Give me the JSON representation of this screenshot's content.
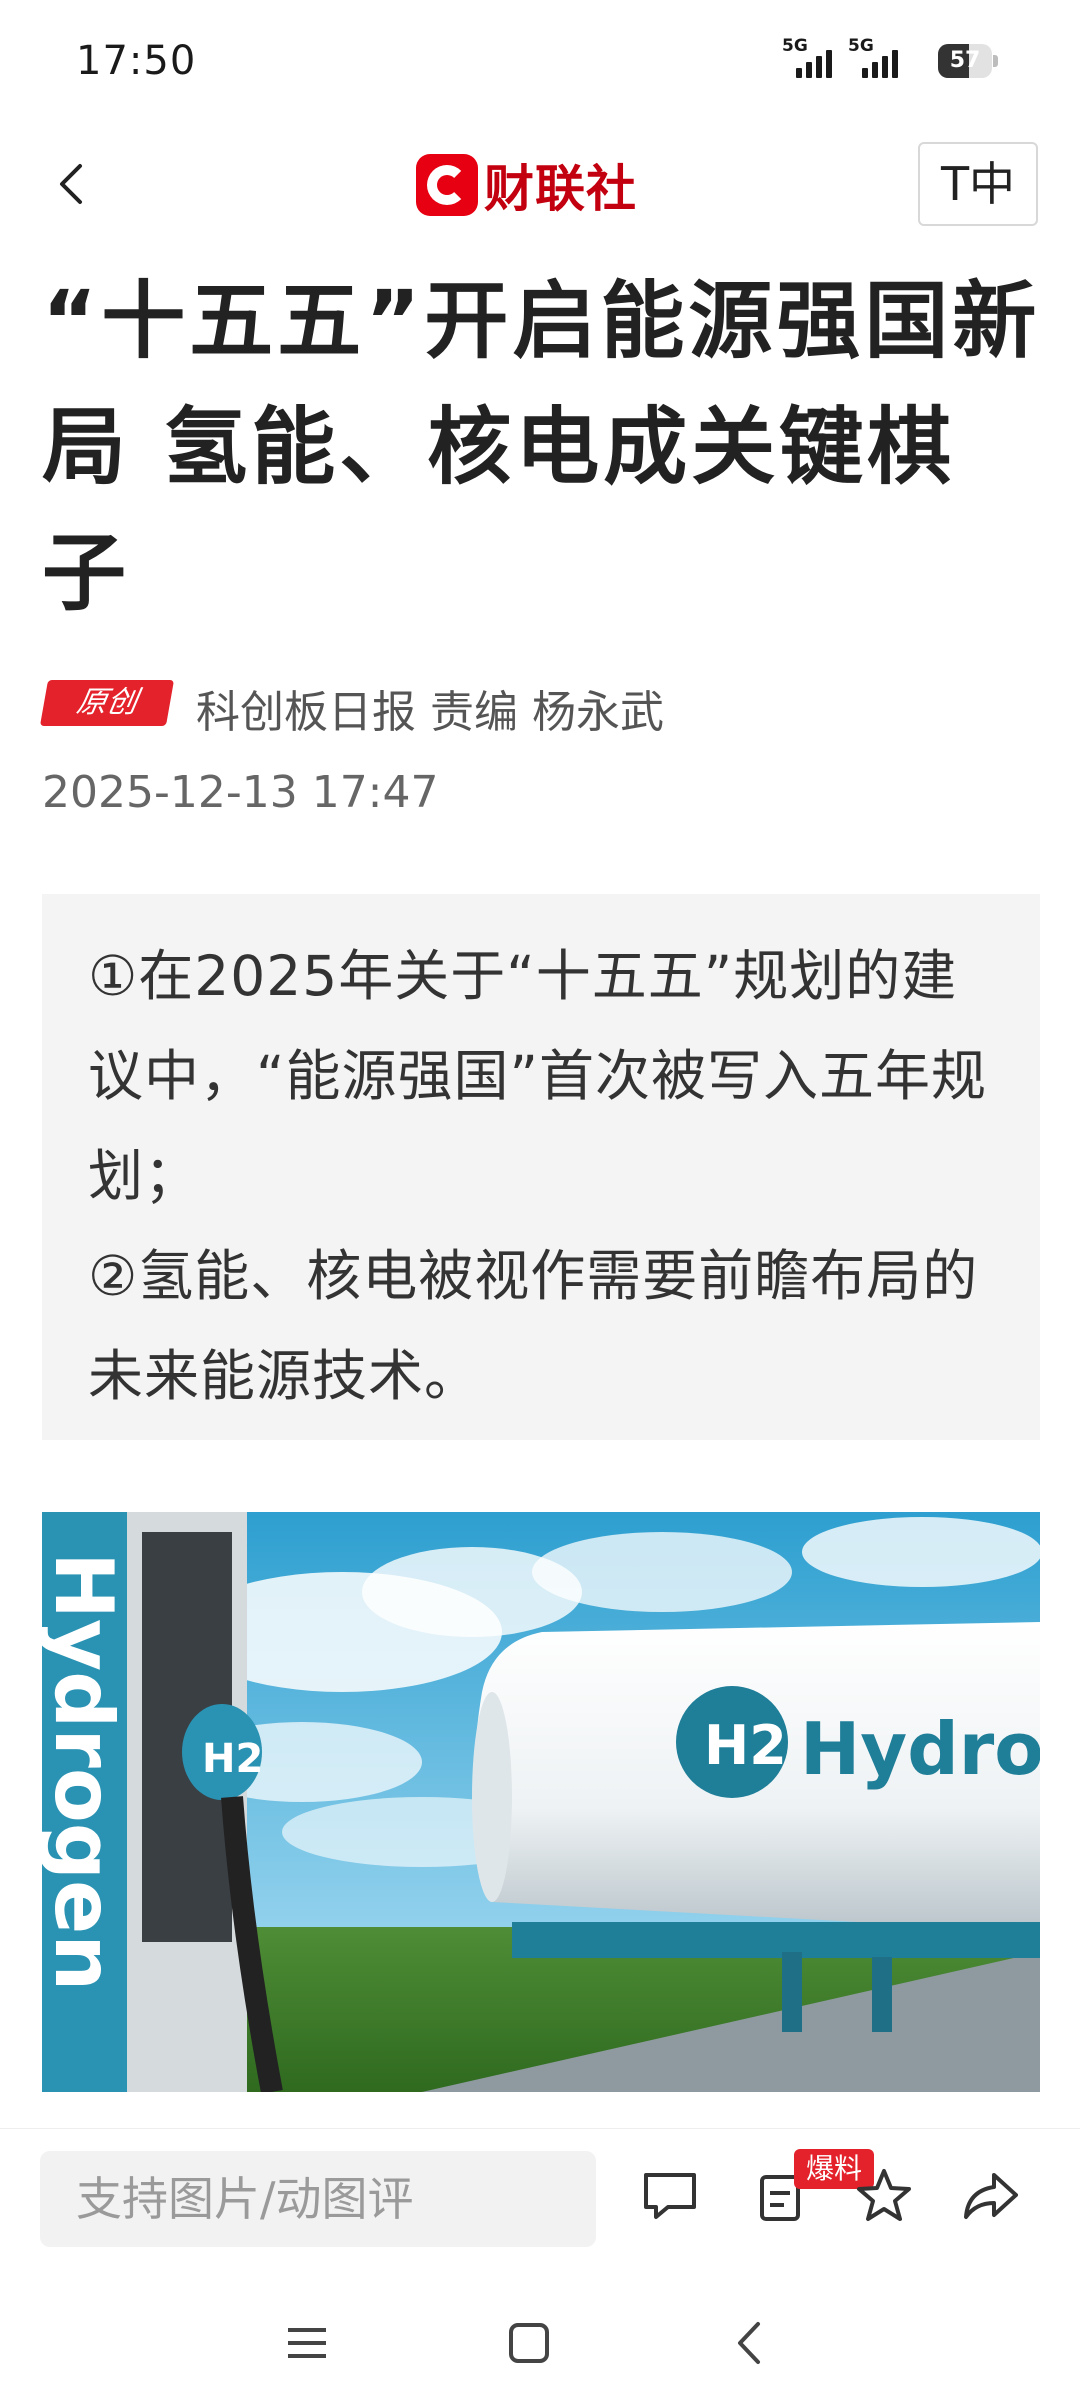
{
  "status": {
    "time": "17:50",
    "signal_1": "5G",
    "signal_2": "5G",
    "battery": "57"
  },
  "nav": {
    "logo_text": "财联社",
    "font_toggle": "T中"
  },
  "article": {
    "title": "“十五五”开启能源强国新局 氢能、核电成关键棋子",
    "badge": "原创",
    "author_line": "科创板日报  责编 杨永武",
    "date": "2025-12-13 17:47",
    "summary": [
      "①在2025年关于“十五五”规划的建议中，“能源强国”首次被写入五年规划；",
      "②氢能、核电被视作需要前瞻布局的未来能源技术。"
    ],
    "image": {
      "side_text": "Hydrogen",
      "nozzle_text": "H2",
      "tank_text": "Hydrogen",
      "tank_logo": "H2"
    }
  },
  "toolbar": {
    "comment_placeholder": "支持图片/动图评",
    "tip_badge": "爆料"
  },
  "icons": {
    "back": "chevron-left-icon",
    "comment": "comment-icon",
    "tip": "tip-icon",
    "favorite": "star-icon",
    "share": "share-icon",
    "menu": "menu-icon",
    "home": "home-icon",
    "sys_back": "back-icon"
  },
  "colors": {
    "brand_red": "#e60012",
    "badge_red": "#e3222b",
    "summary_bg": "#f4f4f4",
    "hydrogen_teal": "#1f7e98"
  }
}
